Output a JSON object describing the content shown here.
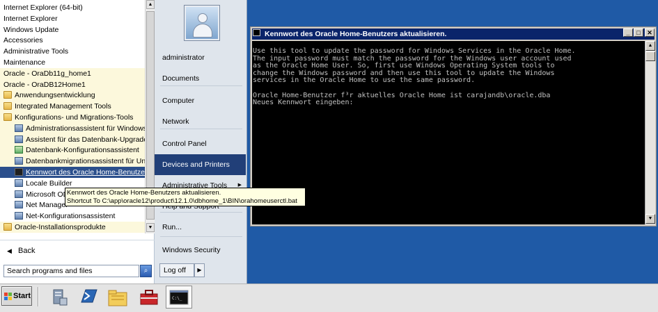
{
  "programs": [
    {
      "label": "Internet Explorer (64-bit)",
      "icon": "",
      "indent": 0,
      "state": ""
    },
    {
      "label": "Internet Explorer",
      "icon": "",
      "indent": 0,
      "state": ""
    },
    {
      "label": "Windows Update",
      "icon": "",
      "indent": 0,
      "state": ""
    },
    {
      "label": "Accessories",
      "icon": "",
      "indent": 0,
      "state": ""
    },
    {
      "label": "Administrative Tools",
      "icon": "",
      "indent": 0,
      "state": ""
    },
    {
      "label": "Maintenance",
      "icon": "",
      "indent": 0,
      "state": ""
    },
    {
      "label": "Oracle - OraDb11g_home1",
      "icon": "",
      "indent": 0,
      "state": "new"
    },
    {
      "label": "Oracle - OraDB12Home1",
      "icon": "",
      "indent": 0,
      "state": "new"
    },
    {
      "label": "Anwendungsentwicklung",
      "icon": "folder",
      "indent": 0,
      "state": "new"
    },
    {
      "label": "Integrated Management Tools",
      "icon": "folder",
      "indent": 0,
      "state": "new"
    },
    {
      "label": "Konfigurations- und Migrations-Tools",
      "icon": "folder",
      "indent": 0,
      "state": "new"
    },
    {
      "label": "Administrationsassistent für Windows",
      "icon": "app",
      "indent": 1,
      "state": "new"
    },
    {
      "label": "Assistent für das Datenbank-Upgrade",
      "icon": "app",
      "indent": 1,
      "state": "new"
    },
    {
      "label": "Datenbank-Konfigurationsassistent",
      "icon": "app green",
      "indent": 1,
      "state": "new"
    },
    {
      "label": "Datenbankmigrationsassistent für Unicode",
      "icon": "app",
      "indent": 1,
      "state": "new"
    },
    {
      "label": "Kennwort des Oracle Home-Benutzers aktualisieren.",
      "icon": "app dark",
      "indent": 1,
      "state": "sel"
    },
    {
      "label": "Locale Builder",
      "icon": "app",
      "indent": 1,
      "state": ""
    },
    {
      "label": "Microsoft ODBC Administrator",
      "icon": "app",
      "indent": 1,
      "state": ""
    },
    {
      "label": "Net Manager",
      "icon": "app",
      "indent": 1,
      "state": ""
    },
    {
      "label": "Net-Konfigurationsassistent",
      "icon": "app",
      "indent": 1,
      "state": ""
    },
    {
      "label": "Oracle-Installationsprodukte",
      "icon": "folder",
      "indent": 0,
      "state": "new"
    }
  ],
  "back_label": "Back",
  "search": {
    "placeholder": "Search programs and files"
  },
  "right_items": [
    {
      "label": "administrator",
      "state": ""
    },
    {
      "label": "Documents",
      "state": ""
    },
    {
      "label": "Computer",
      "state": ""
    },
    {
      "label": "Network",
      "state": ""
    },
    {
      "label": "Control Panel",
      "state": ""
    },
    {
      "label": "Devices and Printers",
      "state": "sel"
    },
    {
      "label": "Administrative Tools",
      "state": "",
      "arrow": "▶"
    },
    {
      "label": "Help and Support",
      "state": ""
    },
    {
      "label": "Run...",
      "state": ""
    },
    {
      "label": "Windows Security",
      "state": ""
    }
  ],
  "logoff_label": "Log off",
  "logoff_arrow": "▶",
  "tooltip": {
    "line1": "Kennwort des Oracle Home-Benutzers aktualisieren.",
    "line2": "Shortcut To C:\\app\\oracle12\\product\\12.1.0\\dbhome_1\\BIN\\orahomeuserctl.bat"
  },
  "console": {
    "title": "Kennwort des Oracle Home-Benutzers aktualisieren.",
    "text": "Use this tool to update the password for Windows Services in the Oracle Home.\nThe input password must match the password for the Windows user account used\nas the Oracle Home User. So, first use Windows Operating System tools to\nchange the Windows password and then use this tool to update the Windows\nservices in the Oracle Home to use the same password.\n\nOracle Home-Benutzer f³r aktuelles Oracle Home ist carajandb\\oracle.dba\nNeues Kennwort eingeben:"
  },
  "taskbar": {
    "start_label": "Start",
    "buttons": [
      {
        "name": "server-manager-icon"
      },
      {
        "name": "powershell-icon"
      },
      {
        "name": "file-explorer-icon"
      },
      {
        "name": "toolbox-icon"
      },
      {
        "name": "command-prompt-icon",
        "active": true
      }
    ]
  },
  "colors": {
    "desktop": "#1f5aa6",
    "selection": "#2b4f8c",
    "new_program_highlight": "#fcf8dc"
  }
}
